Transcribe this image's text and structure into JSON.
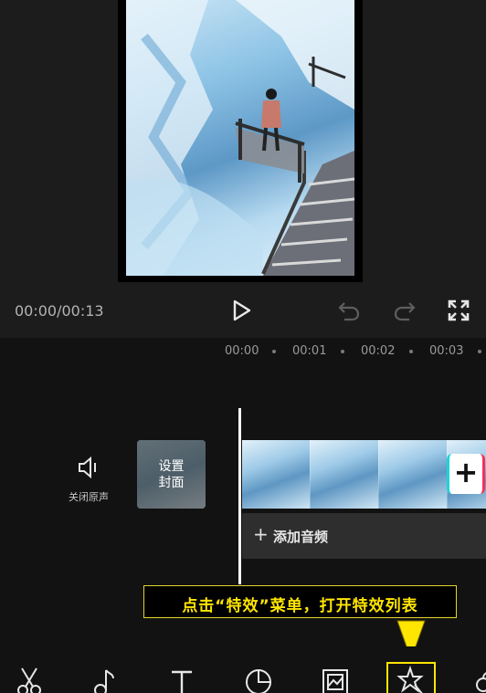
{
  "player": {
    "timecode": "00:00/00:13"
  },
  "ruler": {
    "ticks": [
      "00:00",
      "00:01",
      "00:02",
      "00:03"
    ]
  },
  "tracks": {
    "mute_label": "关闭原声",
    "cover_label_line1": "设置",
    "cover_label_line2": "封面",
    "add_clip_symbol": "+",
    "add_audio_symbol": "+",
    "add_audio_label": "添加音频"
  },
  "annotation": {
    "text": "点击“特效”菜单，打开特效列表",
    "color": "#ffe600"
  },
  "toolbar": {
    "items": [
      "scissors-icon",
      "music-note-icon",
      "text-icon",
      "sticker-icon",
      "filter-icon",
      "effects-icon",
      "more-icon"
    ],
    "highlighted": "effects-icon"
  },
  "colors": {
    "background": "#121212",
    "panel": "#1c1c1c",
    "accent": "#ffe600"
  }
}
